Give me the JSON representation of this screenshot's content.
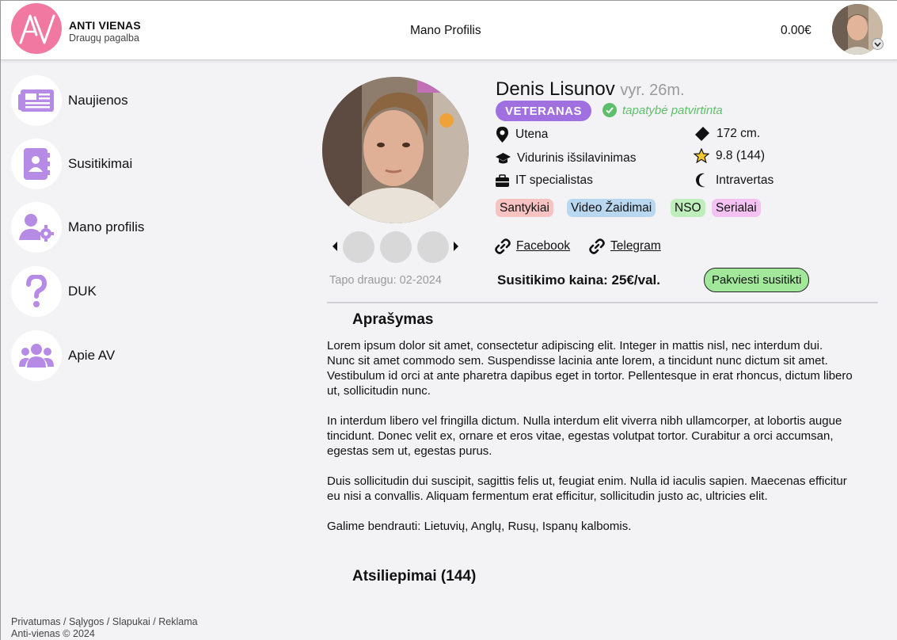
{
  "brand": {
    "name": "ANTI VIENAS",
    "subtitle": "Draugų pagalba",
    "logo_text": "AV",
    "color": "#f178a1"
  },
  "header": {
    "title": "Mano Profilis",
    "balance": "0.00€"
  },
  "sidebar": {
    "items": [
      {
        "label": "Naujienos",
        "icon": "newspaper-icon"
      },
      {
        "label": "Susitikimai",
        "icon": "contact-book-icon"
      },
      {
        "label": "Mano profilis",
        "icon": "user-gear-icon"
      },
      {
        "label": "DUK",
        "icon": "question-icon"
      },
      {
        "label": "Apie AV",
        "icon": "users-icon"
      }
    ],
    "icon_color": "#b68be6"
  },
  "footer": {
    "links": [
      "Privatumas",
      "Sąlygos",
      "Slapukai",
      "Reklama"
    ],
    "separator": " / ",
    "copyright": "Anti-vienas © 2024"
  },
  "profile": {
    "name": "Denis Lisunov",
    "gender_age": "vyr. 26m.",
    "rank": "VETERANAS",
    "verified": "tapatybė patvirtinta",
    "city": "Utena",
    "education": "Vidurinis išsilavinimas",
    "job": "IT specialistas",
    "height": "172 cm.",
    "rating": "9.8 (144)",
    "personality": "Intravertas",
    "tags": [
      {
        "label": "Santykiai",
        "color": "#f6c2c2"
      },
      {
        "label": "Video Žaidimai",
        "color": "#b9d8f0"
      },
      {
        "label": "NSO",
        "color": "#bdeebc"
      },
      {
        "label": "Serialai",
        "color": "#f4c2f2"
      }
    ],
    "social": [
      {
        "label": "Facebook"
      },
      {
        "label": "Telegram"
      }
    ],
    "member_since": "Tapo draugu: 02-2024",
    "price": "Susitikimo kaina: 25€/val.",
    "invite_label": "Pakviesti susitikti",
    "description_title": "Aprašymas",
    "description": [
      "Lorem ipsum dolor sit amet, consectetur adipiscing elit. Integer in  mattis nisl, nec interdum dui. Nunc sit amet commodo sem. Suspendisse  lacinia ante lorem, a tincidunt nunc dictum sit amet. Vestibulum id orci  at ante pharetra dapibus eget in tortor. Pellentesque in erat rhoncus,  dictum libero ut, sollicitudin nunc.",
      "In interdum libero vel fringilla  dictum. Nulla interdum elit viverra nibh ullamcorper, at lobortis augue  tincidunt. Donec velit ex, ornare et eros vitae, egestas volutpat  tortor. Curabitur a orci accumsan, egestas sem ut, egestas purus.",
      "Duis sollicitudin dui suscipit, sagittis felis ut, feugiat enim. Nulla  id iaculis sapien. Maecenas efficitur eu nisi a convallis. Aliquam  fermentum erat efficitur, sollicitudin justo ac, ultricies elit.",
      "Galime bendrauti: Lietuvių, Anglų, Rusų, Ispanų kalbomis."
    ],
    "reviews_title": "Atsiliepimai (144)"
  },
  "colors": {
    "rank": "#a070e0",
    "verified": "#5fbe6b",
    "invite": "#a2e89b"
  }
}
